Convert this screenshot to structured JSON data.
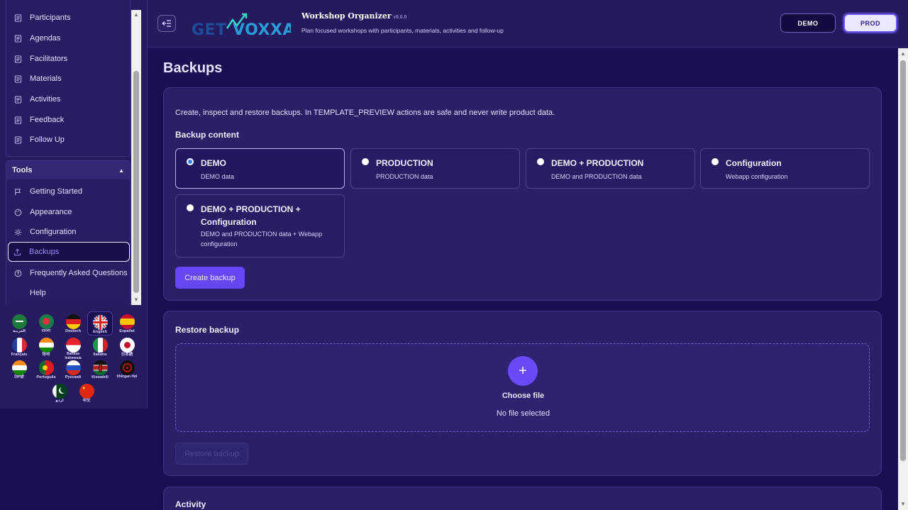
{
  "sidebar": {
    "top_items": [
      {
        "label": "Participants",
        "icon": "list-icon"
      },
      {
        "label": "Agendas",
        "icon": "list-icon"
      },
      {
        "label": "Facilitators",
        "icon": "list-icon"
      },
      {
        "label": "Materials",
        "icon": "list-icon"
      },
      {
        "label": "Activities",
        "icon": "list-icon"
      },
      {
        "label": "Feedback",
        "icon": "list-icon"
      },
      {
        "label": "Follow Up",
        "icon": "list-icon"
      }
    ],
    "tools_title": "Tools",
    "tools_items": [
      {
        "label": "Getting Started",
        "icon": "flag-icon"
      },
      {
        "label": "Appearance",
        "icon": "palette-icon"
      },
      {
        "label": "Configuration",
        "icon": "gear-icon"
      },
      {
        "label": "Backups",
        "icon": "upload-icon"
      },
      {
        "label": "Frequently Asked Questions",
        "icon": "help-circle-icon"
      },
      {
        "label": "Help",
        "icon": ""
      }
    ],
    "active_item": "Backups"
  },
  "languages": [
    {
      "label": "العربية",
      "code": "sa"
    },
    {
      "label": "বাংলা",
      "code": "bd"
    },
    {
      "label": "Deutsch",
      "code": "de"
    },
    {
      "label": "English",
      "code": "gb"
    },
    {
      "label": "Español",
      "code": "es"
    },
    {
      "label": "Français",
      "code": "fr"
    },
    {
      "label": "हिन्दी",
      "code": "in"
    },
    {
      "label": "Bahasa Indonesia",
      "code": "id"
    },
    {
      "label": "Italiano",
      "code": "it"
    },
    {
      "label": "日本語",
      "code": "jp"
    },
    {
      "label": "ਪੰਜਾਬੀ",
      "code": "in"
    },
    {
      "label": "Português",
      "code": "pt"
    },
    {
      "label": "Русский",
      "code": "ru"
    },
    {
      "label": "Kiswahili",
      "code": "ke"
    },
    {
      "label": "tlhIngan Hol",
      "code": "kl"
    },
    {
      "label": "اردو",
      "code": "pk"
    },
    {
      "label": "中文",
      "code": "cn"
    }
  ],
  "active_language": "English",
  "header": {
    "logo_text": "GETVOXXA",
    "title": "Workshop Organizer",
    "version": "v9.0.0",
    "subtitle": "Plan focused workshops with participants, materials, activities and follow-up",
    "env_demo": "DEMO",
    "env_prod": "PROD",
    "active_env": "PROD"
  },
  "page": {
    "title": "Backups",
    "intro": "Create, inspect and restore backups. In TEMPLATE_PREVIEW actions are safe and never write product data.",
    "content_title": "Backup content",
    "options": [
      {
        "label": "DEMO",
        "desc": "DEMO data",
        "selected": true
      },
      {
        "label": "PRODUCTION",
        "desc": "PRODUCTION data",
        "selected": false
      },
      {
        "label": "DEMO + PRODUCTION",
        "desc": "DEMO and PRODUCTION data",
        "selected": false
      },
      {
        "label": "Configuration",
        "desc": "Webapp configuration",
        "selected": false
      },
      {
        "label": "DEMO + PRODUCTION + Configuration",
        "desc": "DEMO and PRODUCTION data + Webapp configuration",
        "selected": false
      }
    ],
    "create_button": "Create backup",
    "restore_title": "Restore backup",
    "choose_file": "Choose file",
    "no_file": "No file selected",
    "restore_button": "Restore backup",
    "activity_title": "Activity"
  },
  "colors": {
    "background": "#1a0f52",
    "sidebar": "#261b5e",
    "card": "#2a2068",
    "accent": "#6646f5",
    "active_border": "#ece8ff"
  }
}
